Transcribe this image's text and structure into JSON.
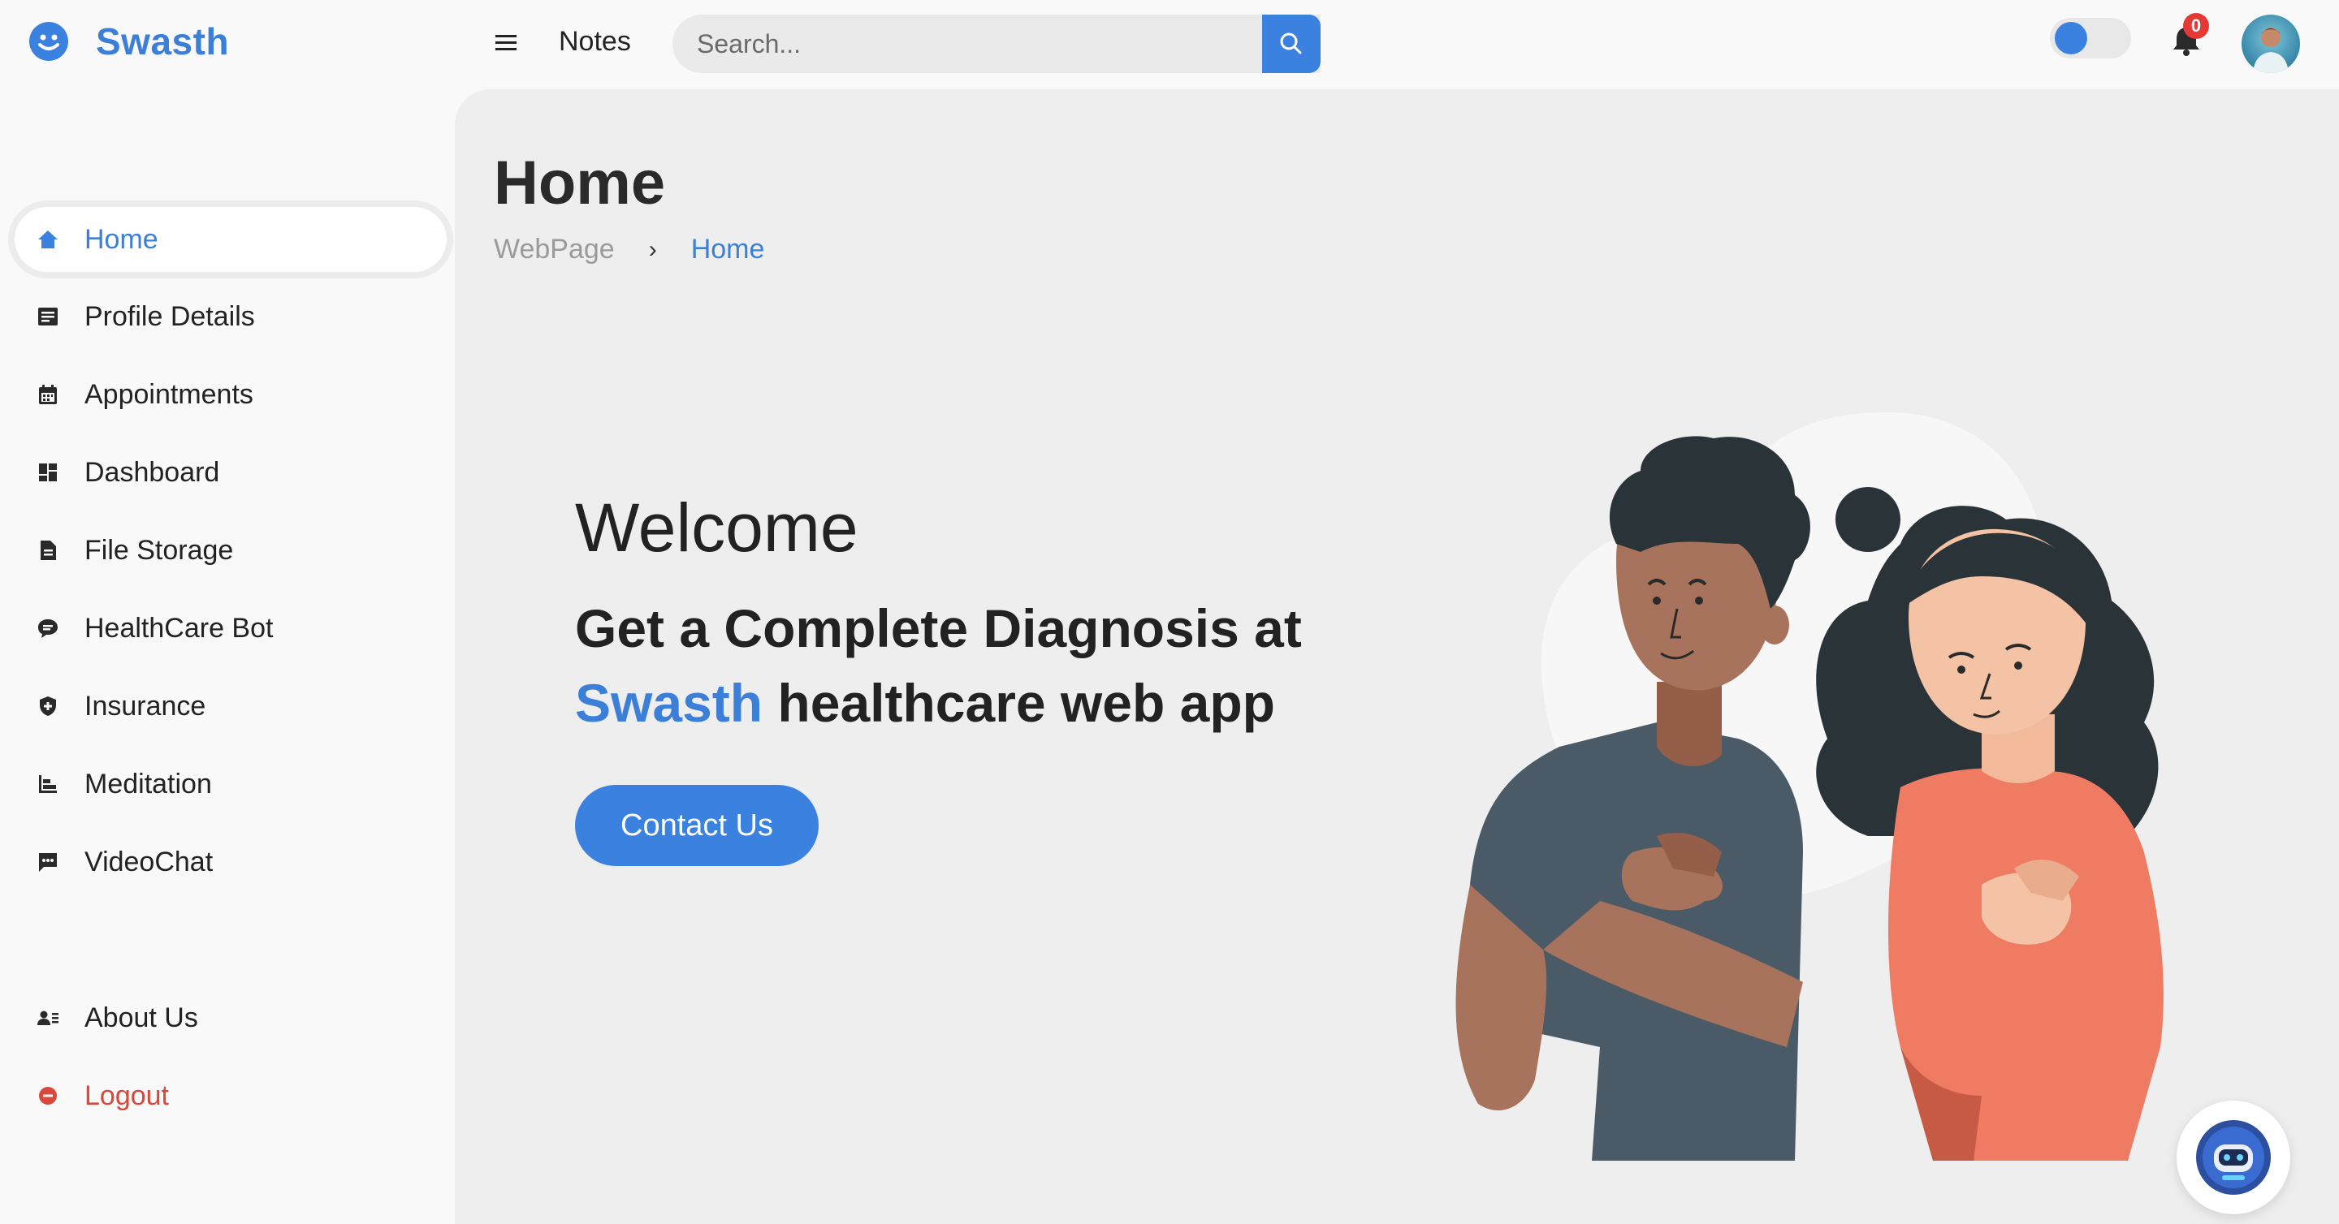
{
  "brand": {
    "name": "Swasth",
    "icon": "smiley-icon"
  },
  "topbar": {
    "menu_icon": "hamburger-icon",
    "notes_label": "Notes",
    "search_placeholder": "Search...",
    "search_icon": "search-icon",
    "notifications_count": "0",
    "toggle_state": "on"
  },
  "sidebar": {
    "items": [
      {
        "label": "Home",
        "icon": "home-icon",
        "active": true
      },
      {
        "label": "Profile Details",
        "icon": "profile-card-icon"
      },
      {
        "label": "Appointments",
        "icon": "calendar-icon"
      },
      {
        "label": "Dashboard",
        "icon": "dashboard-icon"
      },
      {
        "label": "File Storage",
        "icon": "file-icon"
      },
      {
        "label": "HealthCare Bot",
        "icon": "chat-bubble-icon"
      },
      {
        "label": "Insurance",
        "icon": "shield-icon"
      },
      {
        "label": "Meditation",
        "icon": "bars-icon"
      },
      {
        "label": "VideoChat",
        "icon": "video-chat-icon"
      },
      {
        "label": "About Us",
        "icon": "about-icon"
      },
      {
        "label": "Logout",
        "icon": "logout-icon"
      }
    ]
  },
  "main": {
    "title": "Home",
    "breadcrumb": [
      "WebPage",
      "Home"
    ],
    "hero": {
      "welcome": "Welcome",
      "headline_part1": "Get a Complete Diagnosis at",
      "headline_accent": "Swasth",
      "headline_part2": "healthcare web app",
      "cta": "Contact Us"
    }
  },
  "chatbot_icon": "robot-icon",
  "colors": {
    "accent": "#3b82e0",
    "logout": "#d9483b",
    "badge": "#e53935"
  }
}
